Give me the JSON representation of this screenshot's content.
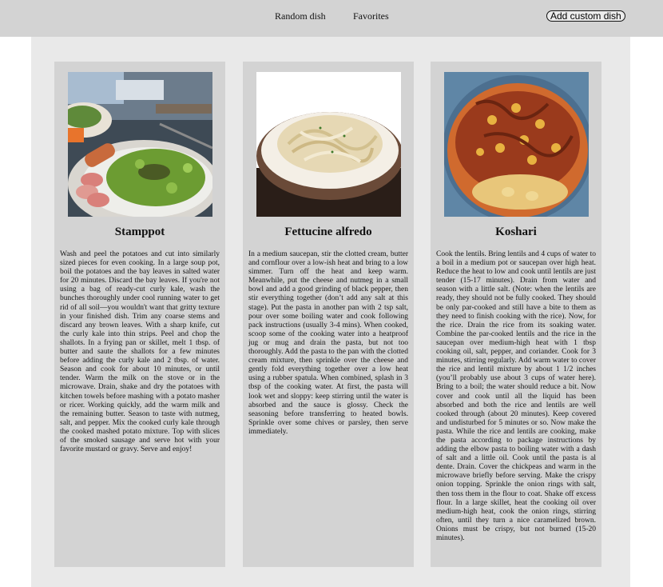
{
  "nav": {
    "random_label": "Random dish",
    "favorites_label": "Favorites",
    "add_label": "Add custom dish"
  },
  "dishes": [
    {
      "title": "Stamppot",
      "image": "stamppot-photo",
      "recipe": "Wash and peel the potatoes and cut into similarly sized pieces for even cooking. In a large soup pot, boil the potatoes and the bay leaves in salted water for 20 minutes. Discard the bay leaves. If you're not using a bag of ready-cut curly kale, wash the bunches thoroughly under cool running water to get rid of all soil—you wouldn't want that gritty texture in your finished dish. Trim any coarse stems and discard any brown leaves. With a sharp knife, cut the curly kale into thin strips. Peel and chop the shallots. In a frying pan or skillet, melt 1 tbsp. of butter and saute the shallots for a few minutes before adding the curly kale and 2 tbsp. of water. Season and cook for about 10 minutes, or until tender. Warm the milk on the stove or in the microwave. Drain, shake and dry the potatoes with kitchen towels before mashing with a potato masher or ricer. Working quickly, add the warm milk and the remaining butter. Season to taste with nutmeg, salt, and pepper. Mix the cooked curly kale through the cooked mashed potato mixture. Top with slices of the smoked sausage and serve hot with your favorite mustard or gravy. Serve and enjoy!"
    },
    {
      "title": "Fettucine alfredo",
      "image": "fettucine-alfredo-photo",
      "recipe": "In a medium saucepan, stir the clotted cream, butter and cornflour over a low-ish heat and bring to a low simmer. Turn off the heat and keep warm. Meanwhile, put the cheese and nutmeg in a small bowl and add a good grinding of black pepper, then stir everything together (don’t add any salt at this stage). Put the pasta in another pan with 2 tsp salt, pour over some boiling water and cook following pack instructions (usually 3-4 mins). When cooked, scoop some of the cooking water into a heatproof jug or mug and drain the pasta, but not too thoroughly. Add the pasta to the pan with the clotted cream mixture, then sprinkle over the cheese and gently fold everything together over a low heat using a rubber spatula. When combined, splash in 3 tbsp of the cooking water. At first, the pasta will look wet and sloppy: keep stirring until the water is absorbed and the sauce is glossy. Check the seasoning before transferring to heated bowls. Sprinkle over some chives or parsley, then serve immediately."
    },
    {
      "title": "Koshari",
      "image": "koshari-photo",
      "recipe": "Cook the lentils. Bring lentils and 4 cups of water to a boil in a medium pot or saucepan over high heat. Reduce the heat to low and cook until lentils are just tender (15-17 minutes). Drain from water and season with a little salt. (Note: when the lentils are ready, they should not be fully cooked. They should be only par-cooked and still have a bite to them as they need to finish cooking with the rice). Now, for the rice. Drain the rice from its soaking water. Combine the par-cooked lentils and the rice in the saucepan over medium-high heat with 1 tbsp cooking oil, salt, pepper, and coriander. Cook for 3 minutes, stirring regularly. Add warm water to cover the rice and lentil mixture by about 1 1/2 inches (you’ll probably use about 3 cups of water here). Bring to a boil; the water should reduce a bit. Now cover and cook until all the liquid has been absorbed and both the rice and lentils are well cooked through (about 20 minutes). Keep covered and undisturbed for 5 minutes or so. Now make the pasta. While the rice and lentils are cooking, make the pasta according to package instructions by adding the elbow pasta to boiling water with a dash of salt and a little oil. Cook until the pasta is al dente. Drain. Cover the chickpeas and warm in the microwave briefly before serving. Make the crispy onion topping. Sprinkle the onion rings with salt, then toss them in the flour to coat. Shake off excess flour. In a large skillet, heat the cooking oil over medium-high heat, cook the onion rings, stirring often, until they turn a nice caramelized brown. Onions must be crispy, but not burned (15-20 minutes)."
    }
  ]
}
